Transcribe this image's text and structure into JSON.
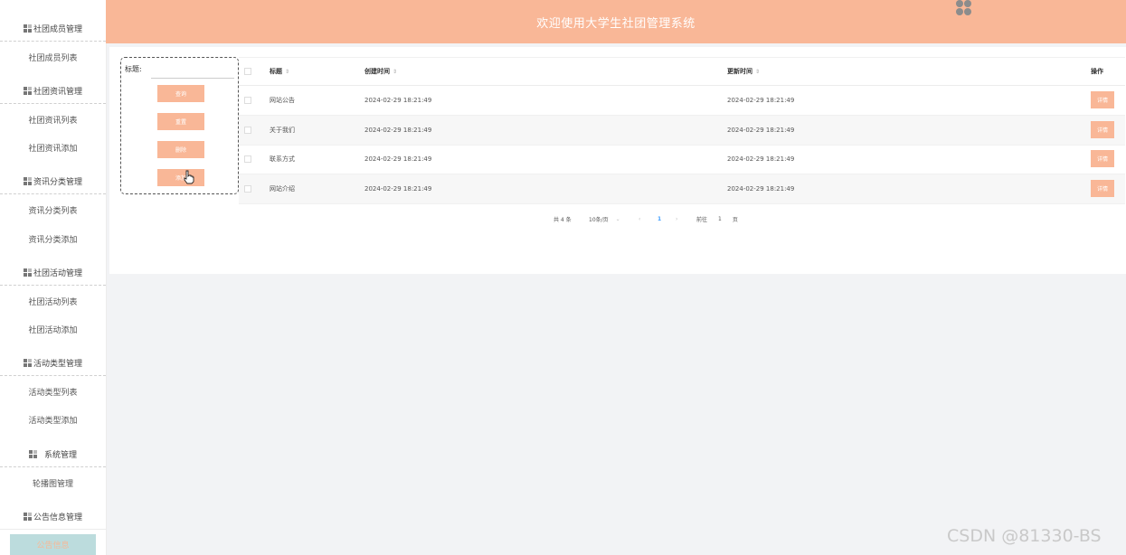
{
  "header": {
    "title": "欢迎使用大学生社团管理系统"
  },
  "sidebar": {
    "groups": [
      {
        "label": "社团成员管理",
        "items": [
          "社团成员列表"
        ]
      },
      {
        "label": "社团资讯管理",
        "items": [
          "社团资讯列表",
          "社团资讯添加"
        ]
      },
      {
        "label": "资讯分类管理",
        "items": [
          "资讯分类列表",
          "资讯分类添加"
        ]
      },
      {
        "label": "社团活动管理",
        "items": [
          "社团活动列表",
          "社团活动添加"
        ]
      },
      {
        "label": "活动类型管理",
        "items": [
          "活动类型列表",
          "活动类型添加"
        ]
      },
      {
        "label": "系统管理",
        "items": [
          "轮播图管理"
        ]
      },
      {
        "label": "公告信息管理",
        "items": []
      }
    ],
    "active_item": "公告信息"
  },
  "search": {
    "label": "标题:",
    "buttons": [
      "查询",
      "重置",
      "删除",
      "添加"
    ]
  },
  "table": {
    "headers": {
      "title": "标题",
      "created": "创建时间",
      "updated": "更新时间",
      "ops": "操作"
    },
    "rows": [
      {
        "title": "网站公告",
        "created": "2024-02-29 18:21:49",
        "updated": "2024-02-29 18:21:49",
        "action": "详情"
      },
      {
        "title": "关于我们",
        "created": "2024-02-29 18:21:49",
        "updated": "2024-02-29 18:21:49",
        "action": "详情"
      },
      {
        "title": "联系方式",
        "created": "2024-02-29 18:21:49",
        "updated": "2024-02-29 18:21:49",
        "action": "详情"
      },
      {
        "title": "网站介绍",
        "created": "2024-02-29 18:21:49",
        "updated": "2024-02-29 18:21:49",
        "action": "详情"
      }
    ]
  },
  "pagination": {
    "total": "共 4 条",
    "page_size": "10条/页",
    "current_page": "1",
    "goto_prefix": "前往",
    "goto_value": "1",
    "goto_suffix": "页"
  },
  "watermark": "CSDN @81330-BS",
  "colors": {
    "accent": "#f9b797",
    "active_bg": "#bcdcdd",
    "page_bg": "#f2f3f5"
  }
}
